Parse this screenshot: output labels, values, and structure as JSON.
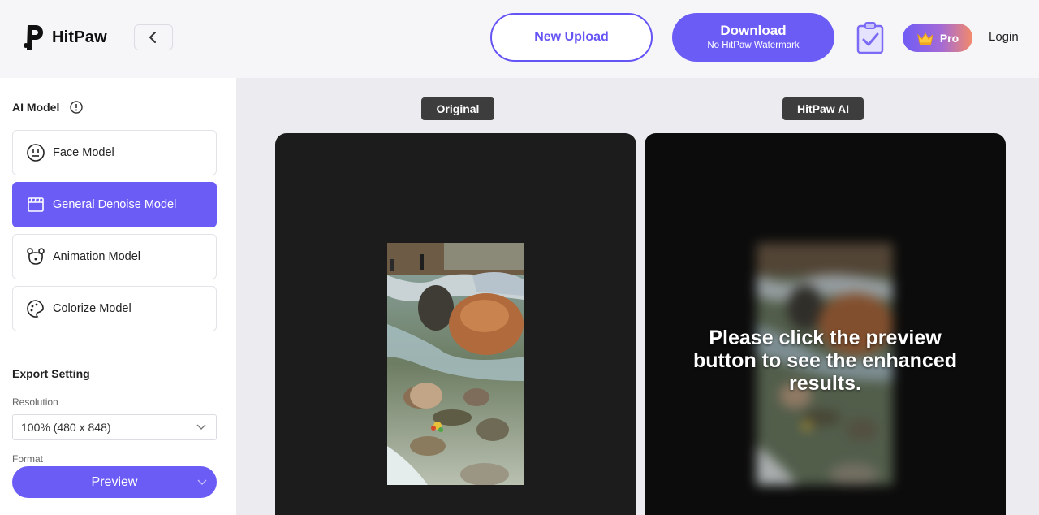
{
  "header": {
    "logo_text": "HitPaw",
    "new_upload_label": "New Upload",
    "download_label": "Download",
    "download_sublabel": "No HitPaw Watermark",
    "pro_label": "Pro",
    "login_label": "Login"
  },
  "sidebar": {
    "ai_model_title": "AI Model",
    "models": [
      {
        "label": "Face Model",
        "icon": "face-icon",
        "active": false
      },
      {
        "label": "General Denoise Model",
        "icon": "film-icon",
        "active": true
      },
      {
        "label": "Animation Model",
        "icon": "bear-icon",
        "active": false
      },
      {
        "label": "Colorize Model",
        "icon": "palette-icon",
        "active": false
      }
    ],
    "export_title": "Export Setting",
    "resolution_label": "Resolution",
    "resolution_value": "100% (480 x 848)",
    "format_label": "Format",
    "preview_label": "Preview"
  },
  "compare": {
    "original_tag": "Original",
    "ai_tag": "HitPaw AI",
    "overlay_message": "Please click the preview button to see the enhanced results."
  },
  "colors": {
    "accent": "#6c5cf6",
    "panel_dark": "#1c1c1c"
  }
}
